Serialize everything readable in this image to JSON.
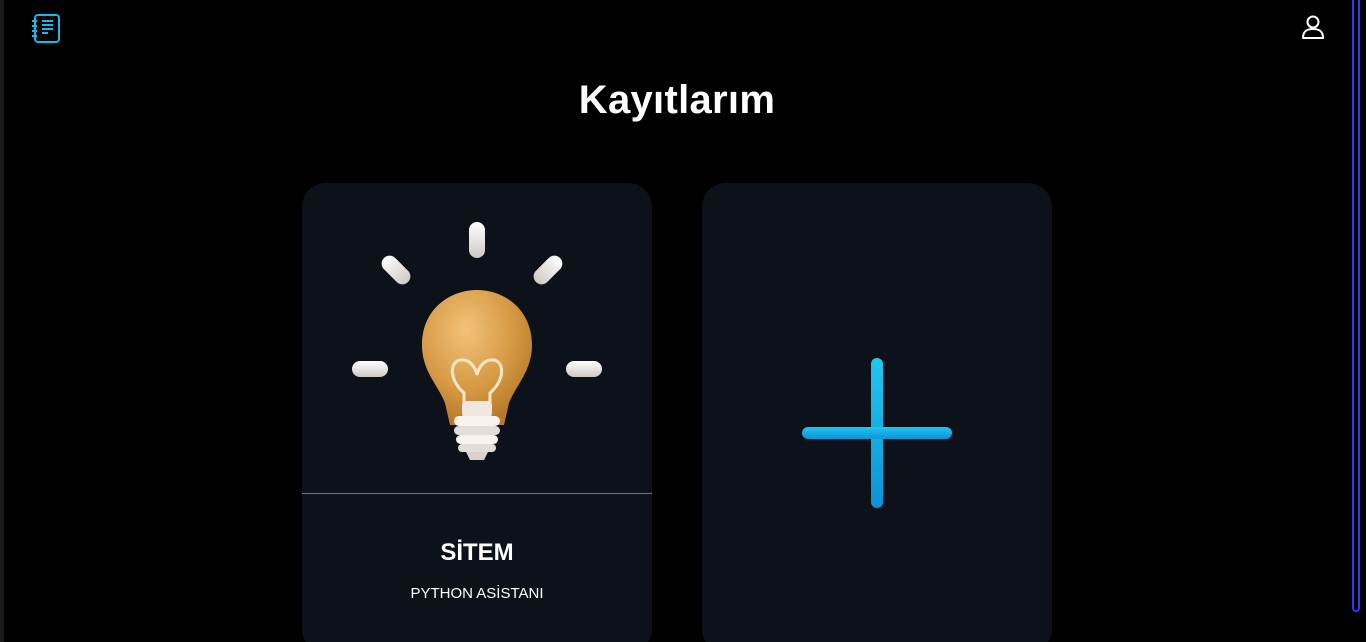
{
  "header": {
    "logo_icon": "notebook-icon",
    "profile_icon": "user-icon"
  },
  "main": {
    "title": "Kayıtlarım",
    "cards": [
      {
        "icon": "lightbulb-icon",
        "title": "SİTEM",
        "subtitle": "PYTHON ASİSTANI"
      },
      {
        "icon": "plus-icon",
        "action": "add"
      }
    ]
  },
  "colors": {
    "accent": "#1ab8e8",
    "card_bg": "#0d1119",
    "divider": "#3d7bd8",
    "scrollbar": "#2a3aff"
  }
}
